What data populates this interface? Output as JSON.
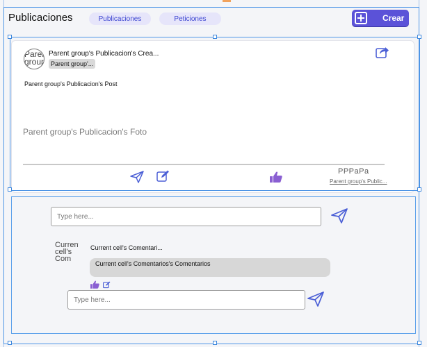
{
  "header": {
    "title": "Publicaciones",
    "tabs": [
      {
        "label": "Publicaciones"
      },
      {
        "label": "Peticiones"
      }
    ],
    "create_label": "Crear"
  },
  "post": {
    "avatar_text": "Parent group",
    "creator_name": "Parent group's Publicacion's Crea...",
    "group_tag": "Parent group'...",
    "post_text": "Parent group's Publicacion's Post",
    "photo_text": "Parent group's Publicacion's Foto",
    "reactors_text": "PPPaPa",
    "link_text": "Parent group's Public..."
  },
  "comments": {
    "input_placeholder": "Type here...",
    "comment_avatar_text": "Current cell's Com",
    "comment_author": "Current cell's Comentari...",
    "comment_text": "Current cell's Comentarios's Comentarios",
    "reply_placeholder": "Type here..."
  },
  "colors": {
    "accent": "#5b52d8",
    "icon_blue": "#4b5fd6",
    "like_purple": "#8a5fd2",
    "selection": "#4d95e6"
  }
}
